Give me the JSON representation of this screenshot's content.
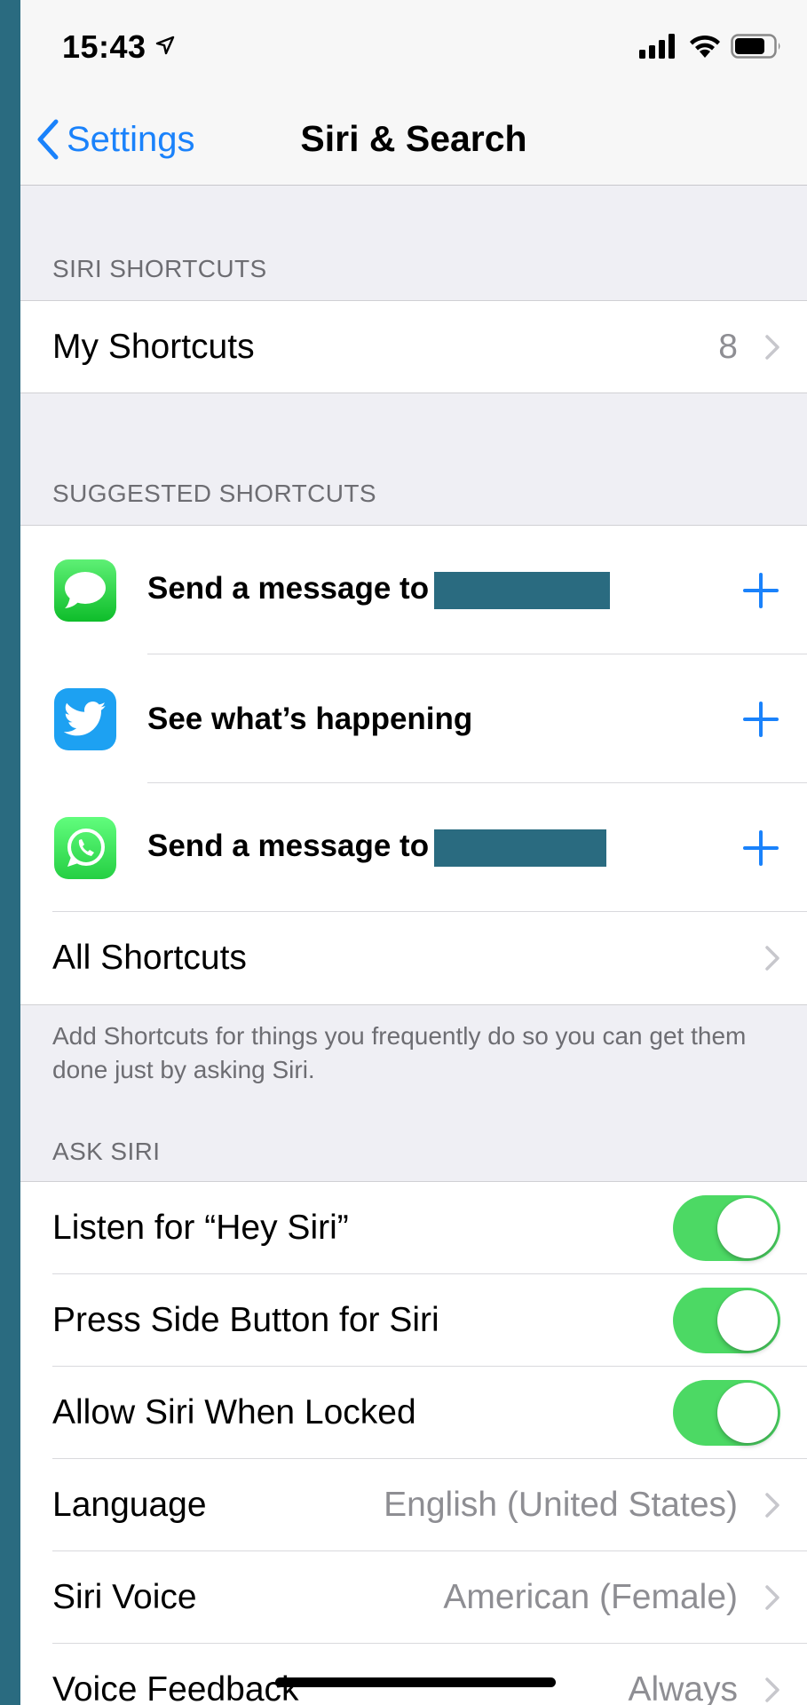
{
  "status_bar": {
    "time": "15:43"
  },
  "nav": {
    "back_label": "Settings",
    "title": "Siri & Search"
  },
  "siri_shortcuts": {
    "header": "SIRI SHORTCUTS",
    "my_shortcuts": {
      "label": "My Shortcuts",
      "count": "8"
    }
  },
  "suggested": {
    "header": "SUGGESTED SHORTCUTS",
    "items": [
      {
        "app_icon": "messages-icon",
        "label": "Send a message to",
        "redacted": true
      },
      {
        "app_icon": "twitter-icon",
        "label": "See what’s happening",
        "redacted": false
      },
      {
        "app_icon": "whatsapp-icon",
        "label": "Send a message to",
        "redacted": true
      }
    ],
    "all_shortcuts": "All Shortcuts",
    "footer": "Add Shortcuts for things you frequently do so you can get them done just by asking Siri."
  },
  "ask_siri": {
    "header": "ASK SIRI",
    "toggles": [
      {
        "label": "Listen for “Hey Siri”",
        "on": true
      },
      {
        "label": "Press Side Button for Siri",
        "on": true
      },
      {
        "label": "Allow Siri When Locked",
        "on": true
      }
    ],
    "language": {
      "label": "Language",
      "value": "English (United States)"
    },
    "siri_voice": {
      "label": "Siri Voice",
      "value": "American (Female)"
    },
    "voice_feedback": {
      "label": "Voice Feedback",
      "value": "Always"
    }
  },
  "colors": {
    "accent": "#1a82fb",
    "toggle_on": "#4cd964",
    "redaction": "#2a6b80",
    "background": "#efeff4"
  }
}
